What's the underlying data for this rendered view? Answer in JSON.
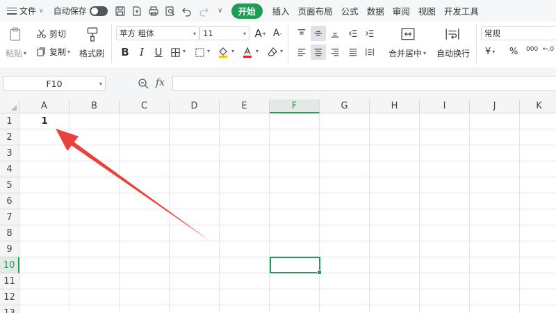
{
  "menubar": {
    "file_label": "文件",
    "autosave_label": "自动保存",
    "tabs": [
      {
        "label": "开始",
        "active": true
      },
      {
        "label": "插入"
      },
      {
        "label": "页面布局"
      },
      {
        "label": "公式"
      },
      {
        "label": "数据"
      },
      {
        "label": "审阅"
      },
      {
        "label": "视图"
      },
      {
        "label": "开发工具"
      }
    ]
  },
  "ribbon": {
    "paste_label": "粘贴",
    "cut_label": "剪切",
    "copy_label": "复制",
    "format_painter_label": "格式刷",
    "font_name": "苹方 粗体",
    "font_size": "11",
    "merge_center_label": "合并居中",
    "wrap_text_label": "自动换行",
    "number_format": "常规",
    "currency_symbol": "¥",
    "percent_symbol": "%",
    "thousands_symbol": "000",
    "decimal_symbol": "←.0"
  },
  "formula_bar": {
    "name_box": "F10",
    "fx_label": "fx",
    "formula_value": ""
  },
  "sheet": {
    "columns": [
      "A",
      "B",
      "C",
      "D",
      "E",
      "F",
      "G",
      "H",
      "I",
      "J",
      "K"
    ],
    "rows": [
      "1",
      "2",
      "3",
      "4",
      "5",
      "6",
      "7",
      "8",
      "9",
      "10",
      "11",
      "12",
      "13"
    ],
    "active_column": "F",
    "active_row": "10",
    "cell_a1": "1"
  },
  "colors": {
    "accent_green": "#1e9e52",
    "arrow_red": "#e8423a"
  }
}
